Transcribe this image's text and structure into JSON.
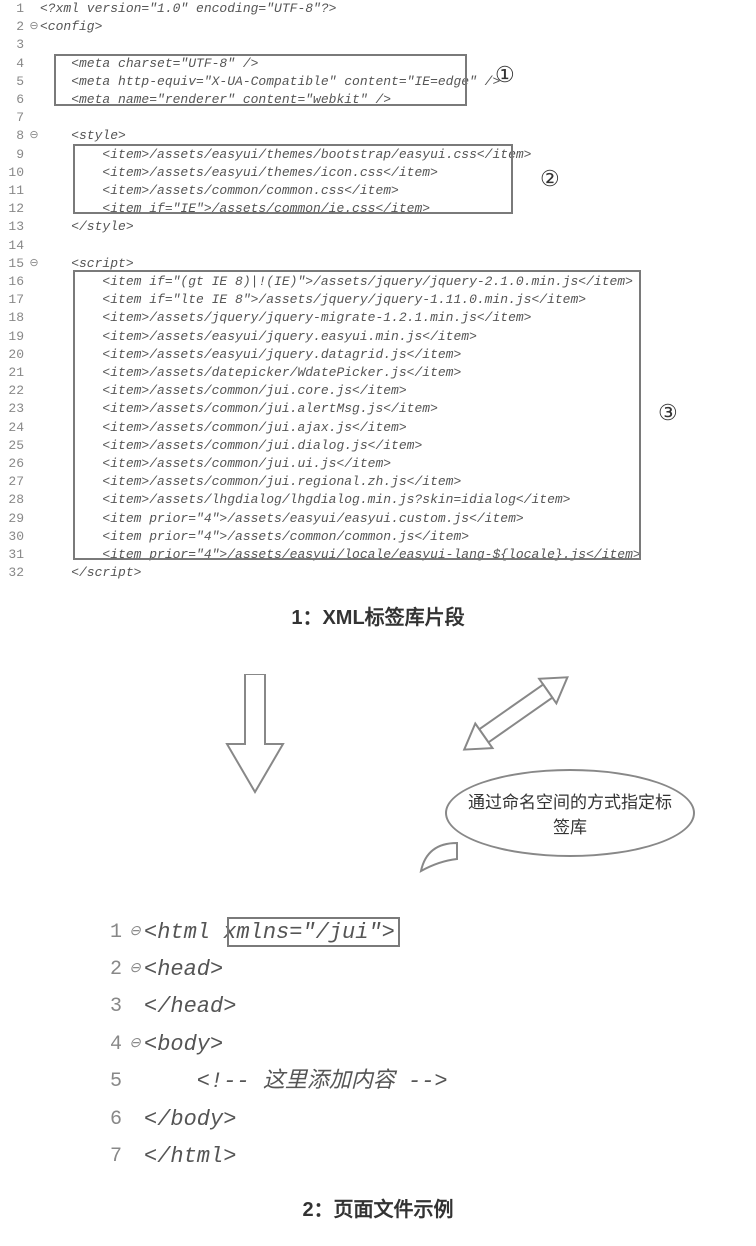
{
  "editor1": {
    "lines": [
      {
        "num": "1",
        "fold": "",
        "text": "<?xml version=\"1.0\" encoding=\"UTF-8\"?>"
      },
      {
        "num": "2",
        "fold": "⊖",
        "text": "<config>"
      },
      {
        "num": "3",
        "fold": "",
        "text": ""
      },
      {
        "num": "4",
        "fold": "",
        "text": "    <meta charset=\"UTF-8\" />"
      },
      {
        "num": "5",
        "fold": "",
        "text": "    <meta http-equiv=\"X-UA-Compatible\" content=\"IE=edge\" />"
      },
      {
        "num": "6",
        "fold": "",
        "text": "    <meta name=\"renderer\" content=\"webkit\" />"
      },
      {
        "num": "7",
        "fold": "",
        "text": ""
      },
      {
        "num": "8",
        "fold": "⊖",
        "text": "    <style>"
      },
      {
        "num": "9",
        "fold": "",
        "text": "        <item>/assets/easyui/themes/bootstrap/easyui.css</item>"
      },
      {
        "num": "10",
        "fold": "",
        "text": "        <item>/assets/easyui/themes/icon.css</item>"
      },
      {
        "num": "11",
        "fold": "",
        "text": "        <item>/assets/common/common.css</item>"
      },
      {
        "num": "12",
        "fold": "",
        "text": "        <item if=\"IE\">/assets/common/ie.css</item>"
      },
      {
        "num": "13",
        "fold": "",
        "text": "    </style>"
      },
      {
        "num": "14",
        "fold": "",
        "text": ""
      },
      {
        "num": "15",
        "fold": "⊖",
        "text": "    <script>"
      },
      {
        "num": "16",
        "fold": "",
        "text": "        <item if=\"(gt IE 8)|!(IE)\">/assets/jquery/jquery-2.1.0.min.js</item>"
      },
      {
        "num": "17",
        "fold": "",
        "text": "        <item if=\"lte IE 8\">/assets/jquery/jquery-1.11.0.min.js</item>"
      },
      {
        "num": "18",
        "fold": "",
        "text": "        <item>/assets/jquery/jquery-migrate-1.2.1.min.js</item>"
      },
      {
        "num": "19",
        "fold": "",
        "text": "        <item>/assets/easyui/jquery.easyui.min.js</item>"
      },
      {
        "num": "20",
        "fold": "",
        "text": "        <item>/assets/easyui/jquery.datagrid.js</item>"
      },
      {
        "num": "21",
        "fold": "",
        "text": "        <item>/assets/datepicker/WdatePicker.js</item>"
      },
      {
        "num": "22",
        "fold": "",
        "text": "        <item>/assets/common/jui.core.js</item>"
      },
      {
        "num": "23",
        "fold": "",
        "text": "        <item>/assets/common/jui.alertMsg.js</item>"
      },
      {
        "num": "24",
        "fold": "",
        "text": "        <item>/assets/common/jui.ajax.js</item>"
      },
      {
        "num": "25",
        "fold": "",
        "text": "        <item>/assets/common/jui.dialog.js</item>"
      },
      {
        "num": "26",
        "fold": "",
        "text": "        <item>/assets/common/jui.ui.js</item>"
      },
      {
        "num": "27",
        "fold": "",
        "text": "        <item>/assets/common/jui.regional.zh.js</item>"
      },
      {
        "num": "28",
        "fold": "",
        "text": "        <item>/assets/lhgdialog/lhgdialog.min.js?skin=idialog</item>"
      },
      {
        "num": "29",
        "fold": "",
        "text": "        <item prior=\"4\">/assets/easyui/easyui.custom.js</item>"
      },
      {
        "num": "30",
        "fold": "",
        "text": "        <item prior=\"4\">/assets/common/common.js</item>"
      },
      {
        "num": "31",
        "fold": "",
        "text": "        <item prior=\"4\">/assets/easyui/locale/easyui-lang-${locale}.js</item>"
      },
      {
        "num": "32",
        "fold": "",
        "text": "    </script>"
      }
    ]
  },
  "circled": {
    "one": "①",
    "two": "②",
    "three": "③"
  },
  "caption1": "1：XML标签库片段",
  "caption2": "2：页面文件示例",
  "callout_text": "通过命名空间的方式指定标签库",
  "editor2": {
    "lines": [
      {
        "num": "1",
        "fold": "⊖",
        "text": "<html xmlns=\"/jui\">"
      },
      {
        "num": "2",
        "fold": "⊖",
        "text": "<head>"
      },
      {
        "num": "3",
        "fold": "",
        "text": "</head>"
      },
      {
        "num": "4",
        "fold": "⊖",
        "text": "<body>"
      },
      {
        "num": "5",
        "fold": "",
        "text": "    <!-- 这里添加内容 -->"
      },
      {
        "num": "6",
        "fold": "",
        "text": "</body>"
      },
      {
        "num": "7",
        "fold": "",
        "text": "</html>"
      }
    ]
  }
}
